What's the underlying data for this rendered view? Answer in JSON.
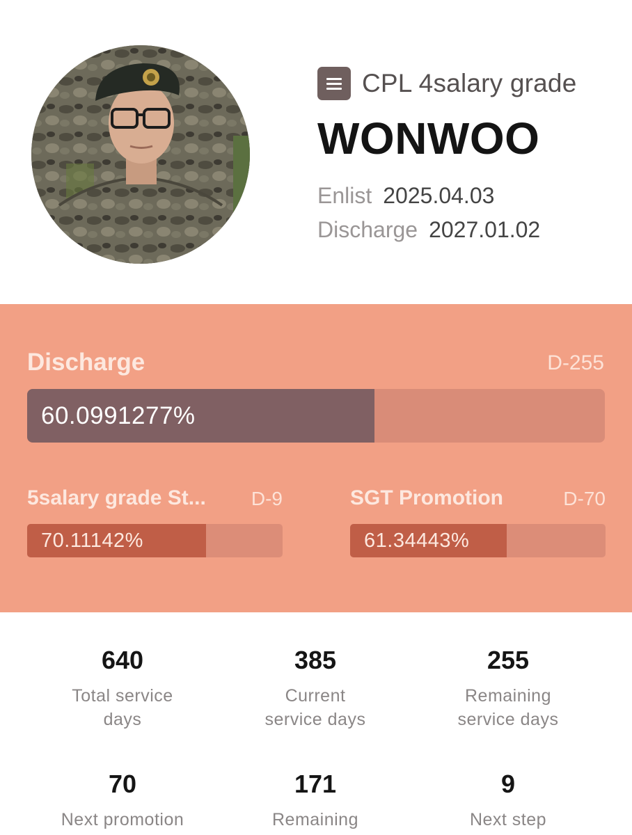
{
  "profile": {
    "rank_icon": "menu-card-icon",
    "rank": "CPL 4salary grade",
    "name": "WONWOO",
    "enlist_label": "Enlist",
    "enlist_date": "2025.04.03",
    "discharge_label": "Discharge",
    "discharge_date": "2027.01.02"
  },
  "progress": {
    "main": {
      "label": "Discharge",
      "dday": "D-255",
      "percent_text": "60.0991277%",
      "fraction": 0.600991277
    },
    "left": {
      "label": "5salary grade St...",
      "dday": "D-9",
      "percent_text": "70.11142%",
      "fraction": 0.7011142
    },
    "right": {
      "label": "SGT Promotion",
      "dday": "D-70",
      "percent_text": "61.34443%",
      "fraction": 0.6134443
    }
  },
  "stats": [
    {
      "value": "640",
      "line1": "Total service",
      "line2": "days"
    },
    {
      "value": "385",
      "line1": "Current",
      "line2": "service days"
    },
    {
      "value": "255",
      "line1": "Remaining",
      "line2": "service days"
    },
    {
      "value": "70",
      "line1": "Next promotion",
      "line2": ""
    },
    {
      "value": "171",
      "line1": "Remaining",
      "line2": ""
    },
    {
      "value": "9",
      "line1": "Next step",
      "line2": ""
    }
  ],
  "colors": {
    "panel": "#f2a085",
    "main_fill": "#806063",
    "sub_fill": "#c05e47",
    "track": "#d98c78"
  }
}
